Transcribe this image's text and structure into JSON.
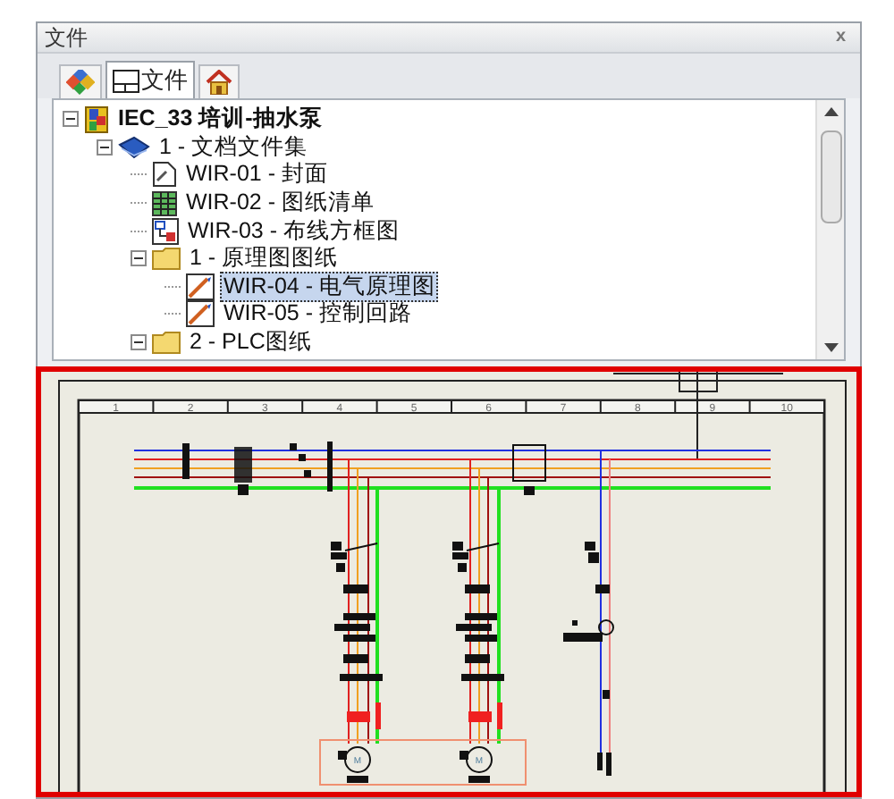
{
  "panel": {
    "title": "文件",
    "close": "x"
  },
  "tabs": [
    {
      "kind": "blocks",
      "selected": false
    },
    {
      "kind": "file",
      "label": "文件",
      "selected": true
    },
    {
      "kind": "home",
      "selected": false
    }
  ],
  "tree": [
    {
      "label": "IEC_33 培训-抽水泵",
      "kind": "project",
      "expanded": true,
      "selected": false,
      "children": [
        {
          "label": "1 - 文档文件集",
          "kind": "book",
          "expanded": true,
          "selected": false,
          "children": [
            {
              "label": "WIR-01 - 封面",
              "kind": "page",
              "selected": false
            },
            {
              "label": "WIR-02 - 图纸清单",
              "kind": "table",
              "selected": false
            },
            {
              "label": "WIR-03 - 布线方框图",
              "kind": "block",
              "selected": false
            },
            {
              "label": "1 - 原理图图纸",
              "kind": "folder",
              "expanded": true,
              "selected": false,
              "children": [
                {
                  "label": "WIR-04 - 电气原理图",
                  "kind": "schematic",
                  "selected": true
                },
                {
                  "label": "WIR-05 - 控制回路",
                  "kind": "schematic",
                  "selected": false
                }
              ]
            },
            {
              "label": "2 - PLC图纸",
              "kind": "folder",
              "expanded": true,
              "selected": false
            }
          ]
        }
      ]
    }
  ],
  "preview": {
    "column_numbers": [
      "1",
      "2",
      "3",
      "4",
      "5",
      "6",
      "7",
      "8",
      "9",
      "10"
    ],
    "motor_labels": [
      "M",
      "M"
    ]
  }
}
